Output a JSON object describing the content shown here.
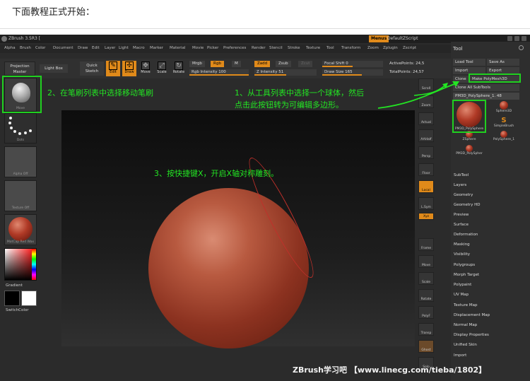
{
  "article": {
    "heading": "下面教程正式开始："
  },
  "app": {
    "title": "ZBrush 3.5R3 [",
    "menus_label": "Menus",
    "script_label": "DefaultZScript",
    "menu": [
      "Alpha",
      "Brush",
      "Color",
      "Document",
      "Draw",
      "Edit",
      "Layer",
      "Light",
      "Macro",
      "Marker",
      "Material",
      "Movie",
      "Picker",
      "Preferences",
      "Render",
      "Stencil",
      "Stroke",
      "Texture",
      "Tool",
      "Transform",
      "Zoom",
      "Zplugin",
      "Zscript"
    ]
  },
  "shelf": {
    "projection_master": "Projection Master",
    "light_box": "Light Box",
    "quick_sketch": "Quick Sketch",
    "modes": {
      "edit": "Edit",
      "draw": "Draw",
      "move": "Move",
      "scale": "Scale",
      "rotate": "Rotate"
    },
    "mrgb": "Mrgb",
    "rgb": "Rgb",
    "m": "M",
    "zadd": "Zadd",
    "zsub": "Zsub",
    "zcut": "Zcut",
    "rgb_intensity": "Rgb Intensity 100",
    "z_intensity": "Z Intensity 51",
    "focal_shift": "Focal Shift 0",
    "draw_size": "Draw Size 165",
    "active_points": "ActivePoints: 24,5",
    "total_points": "TotalPoints: 24,57"
  },
  "left_panel": {
    "brush_caption": "Move",
    "stroke_caption": "Dots",
    "alpha_caption": "Alpha Off",
    "texture_caption": "Texture Off",
    "material_caption": "MatCap Red Wax",
    "gradient_label": "Gradient",
    "switch_color_label": "SwitchColor"
  },
  "right_dock": [
    "Scroll",
    "Zoom",
    "Actual",
    "AAHalf",
    "Persp",
    "Floor",
    "Local",
    "L.Sym",
    "Xyz",
    "Frame",
    "Move",
    "Scale",
    "Rotate",
    "PolyF",
    "Transp",
    "Ghost",
    "Solo"
  ],
  "tool_palette": {
    "title": "Tool",
    "load_tool": "Load Tool",
    "save_as": "Save As",
    "import": "Import",
    "export": "Export",
    "clone": "Clone",
    "make_polymesh": "Make PolyMesh3D",
    "clone_all": "Clone All SubTools",
    "current": "PM3D_PolySphere_1. 48",
    "items": [
      {
        "label": "PM3D_PolySphere"
      },
      {
        "label": "Sphere3D"
      },
      {
        "label": "SimpleBrush"
      },
      {
        "label": "ZSphere"
      },
      {
        "label": "PolySphere_1"
      },
      {
        "label": "PM3D_PolySpher"
      }
    ],
    "sections": [
      "SubTool",
      "Layers",
      "Geometry",
      "Geometry HD",
      "Preview",
      "Surface",
      "Deformation",
      "Masking",
      "Visibility",
      "Polygroups",
      "Morph Target",
      "Polypaint",
      "UV Map",
      "Texture Map",
      "Displacement Map",
      "Normal Map",
      "Display Properties",
      "Unified Skin",
      "Import"
    ]
  },
  "annotations": {
    "step1_line1": "1、从工具列表中选择一个球体，然后",
    "step1_line2": "点击此按钮转为可编辑多边形。",
    "step2": "2、在笔刷列表中选择移动笔刷",
    "step3": "3、按快捷键X，开启X轴对称雕刻。"
  },
  "watermark": "ZBrush学习吧  【www.linecg.com/tieba/1802】",
  "colors": {
    "accent_orange": "#e08a1a",
    "annotation_green": "#23e523",
    "symmetry_ring_red": "#c0302a"
  }
}
